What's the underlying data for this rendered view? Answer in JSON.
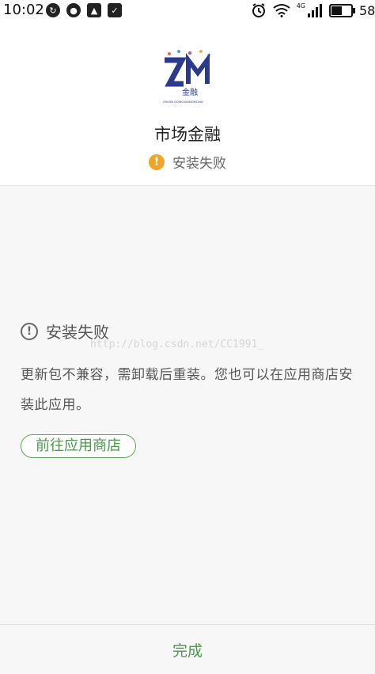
{
  "status_bar": {
    "time": "10:02",
    "battery_text": "58",
    "battery_level": 0.58,
    "network_label": "4G",
    "left_icons": [
      "sync-icon",
      "weibo-icon",
      "image-icon",
      "notification-icon"
    ],
    "right_icons": [
      "alarm-icon",
      "wifi-icon",
      "signal-icon",
      "battery-icon"
    ]
  },
  "app": {
    "name": "市场金融",
    "logo_text": "金融",
    "logo_subtext": "ZHIXIN GONGXIANGRONG",
    "status": "安装失败",
    "status_color": "#f0a526"
  },
  "message": {
    "title": "安装失败",
    "body": "更新包不兼容，需卸载后重装。您也可以在应用商店安装此应用。",
    "store_button": "前往应用商店"
  },
  "watermark": "http://blog.csdn.net/CC1991_",
  "footer": {
    "done_label": "完成"
  },
  "colors": {
    "accent": "#4a9a4a",
    "background": "#f7f7f7"
  }
}
